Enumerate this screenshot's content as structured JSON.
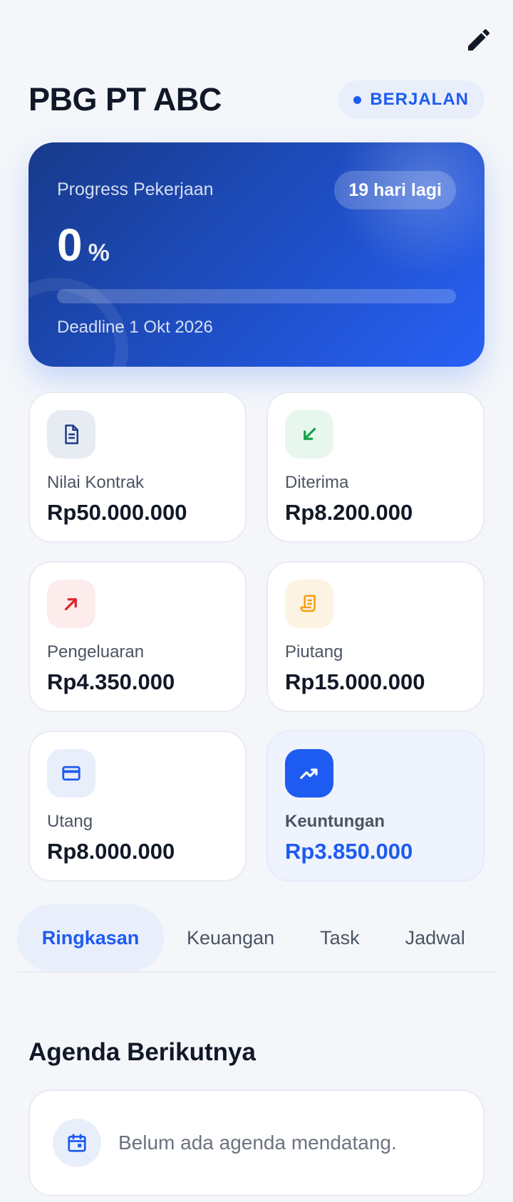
{
  "header": {
    "title": "PBG PT ABC",
    "status": "BERJALAN",
    "edit_icon": "pencil-icon"
  },
  "hero": {
    "label": "Progress Pekerjaan",
    "days_left": "19 hari lagi",
    "progress_value": "0",
    "progress_unit": "%",
    "progress_fraction": 0,
    "deadline": "Deadline 1 Okt 2026"
  },
  "stats": [
    {
      "label": "Nilai Kontrak",
      "value": "Rp50.000.000",
      "icon": "document-icon",
      "icon_color": "#1e3a8a",
      "icon_bg": "#e7ebf2"
    },
    {
      "label": "Diterima",
      "value": "Rp8.200.000",
      "icon": "arrow-down-left-icon",
      "icon_color": "#16a34a",
      "icon_bg": "#e8f7ee"
    },
    {
      "label": "Pengeluaran",
      "value": "Rp4.350.000",
      "icon": "arrow-up-right-icon",
      "icon_color": "#dc2626",
      "icon_bg": "#fdecec"
    },
    {
      "label": "Piutang",
      "value": "Rp15.000.000",
      "icon": "receipt-icon",
      "icon_color": "#f59e0b",
      "icon_bg": "#fdf3e3"
    },
    {
      "label": "Utang",
      "value": "Rp8.000.000",
      "icon": "credit-card-icon",
      "icon_color": "#1e5bf0",
      "icon_bg": "#e9eefb"
    },
    {
      "label": "Keuntungan",
      "value": "Rp3.850.000",
      "icon": "trending-up-icon",
      "icon_color": "#ffffff",
      "icon_bg": "#1e5bf0"
    }
  ],
  "tabs": [
    {
      "label": "Ringkasan",
      "active": true
    },
    {
      "label": "Keuangan",
      "active": false
    },
    {
      "label": "Task",
      "active": false
    },
    {
      "label": "Jadwal",
      "active": false
    }
  ],
  "agenda": {
    "title": "Agenda Berikutnya",
    "empty_text": "Belum ada agenda mendatang.",
    "icon": "calendar-icon"
  },
  "colors": {
    "accent": "#1e5bf0",
    "background": "#f4f6fa"
  }
}
